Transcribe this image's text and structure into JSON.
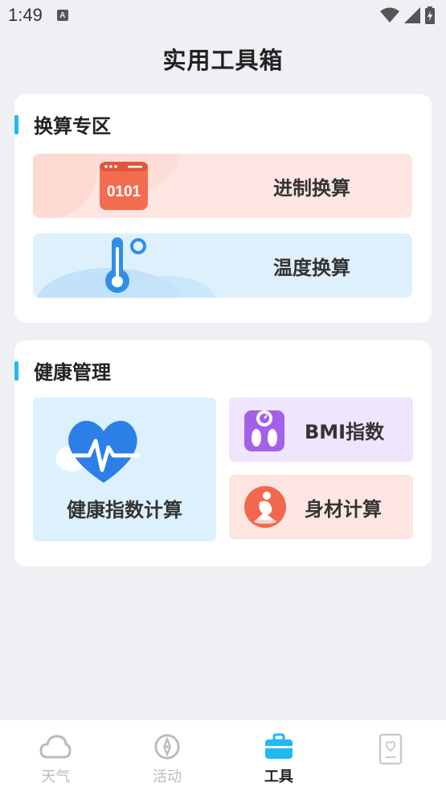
{
  "status_bar": {
    "time": "1:49",
    "notification_letter": "A"
  },
  "page_title": "实用工具箱",
  "sections": {
    "convert": {
      "title": "换算专区",
      "items": [
        {
          "label": "进制换算",
          "icon": "binary-icon",
          "icon_text": "0101"
        },
        {
          "label": "温度换算",
          "icon": "thermometer-icon"
        }
      ]
    },
    "health": {
      "title": "健康管理",
      "items": [
        {
          "label": "健康指数计算",
          "icon": "heart-pulse-icon"
        },
        {
          "label": "BMI指数",
          "icon": "scale-icon"
        },
        {
          "label": "身材计算",
          "icon": "body-icon"
        }
      ]
    }
  },
  "bottom_nav": [
    {
      "label": "天气",
      "icon": "cloud-icon",
      "active": false
    },
    {
      "label": "活动",
      "icon": "compass-icon",
      "active": false
    },
    {
      "label": "工具",
      "icon": "toolbox-icon",
      "active": true
    },
    {
      "label": "",
      "icon": "heart-card-icon",
      "active": false
    }
  ],
  "colors": {
    "accent": "#22b8f0",
    "binary_row_bg": "#fde6e1",
    "temp_row_bg": "#dff0fd",
    "health_tile_bg": "#dcf0fd",
    "bmi_tile_bg": "#efe5fd",
    "body_tile_bg": "#fde6e1"
  }
}
